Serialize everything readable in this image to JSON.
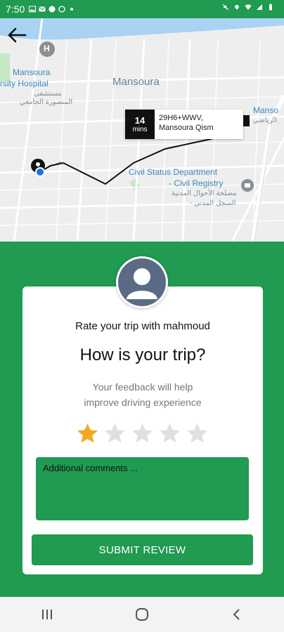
{
  "status_bar": {
    "time": "7:50",
    "left_icons": [
      "image-icon",
      "mail-icon",
      "messenger-icon",
      "whatsapp-icon",
      "dot-icon"
    ],
    "right_icons": [
      "mute-icon",
      "location-icon",
      "wifi-icon",
      "signal-icon",
      "battery-icon"
    ]
  },
  "map": {
    "labels": {
      "mansoura": "Mansoura",
      "hospital_1": "Mansoura",
      "hospital_2": "rsity Hospital",
      "hospital_ar_1": "مستشفى",
      "hospital_ar_2": "المنصورة الجامعي",
      "civil_1": "Civil Status Department",
      "civil_2": "- Civil Registry",
      "civil_ar_1": "مصلحة الأحوال المدنية",
      "civil_ar_2": "- السجل المدني",
      "right_1": "Manso",
      "right_2": "الرياضي"
    },
    "eta": {
      "number": "14",
      "unit": "mins",
      "address_line1": "29H6+WWV,",
      "address_line2": "Mansoura Qism"
    }
  },
  "rating": {
    "title": "Rate your trip with mahmoud",
    "question": "How is your trip?",
    "feedback_line1": "Your feedback will help",
    "feedback_line2": "improve driving experience",
    "rating_value": 1,
    "rating_max": 5,
    "comments_placeholder": "Additional comments ...",
    "submit_label": "SUBMIT REVIEW"
  },
  "colors": {
    "primary_green": "#219a52",
    "star_filled": "#f5a623",
    "star_empty": "#e0e0e0"
  }
}
